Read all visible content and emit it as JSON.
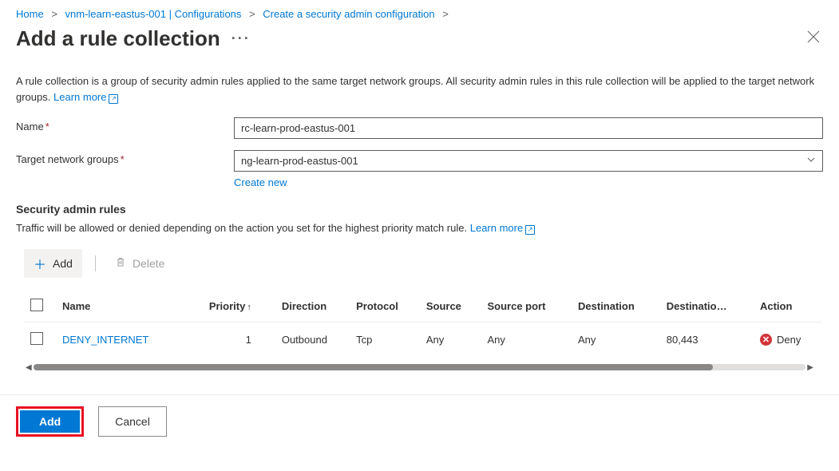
{
  "breadcrumb": {
    "items": [
      "Home",
      "vnm-learn-eastus-001 | Configurations",
      "Create a security admin configuration"
    ],
    "sep": ">"
  },
  "header": {
    "title": "Add a rule collection"
  },
  "description": {
    "text": "A rule collection is a group of security admin rules applied to the same target network groups. All security admin rules in this rule collection will be applied to the target network groups.",
    "learn_more": "Learn more"
  },
  "form": {
    "name_label": "Name",
    "name_value": "rc-learn-prod-eastus-001",
    "target_label": "Target network groups",
    "target_value": "ng-learn-prod-eastus-001",
    "create_new": "Create new"
  },
  "rules_section": {
    "title": "Security admin rules",
    "desc": "Traffic will be allowed or denied depending on the action you set for the highest priority match rule.",
    "learn_more": "Learn more",
    "toolbar": {
      "add": "Add",
      "delete": "Delete"
    },
    "columns": {
      "name": "Name",
      "priority": "Priority",
      "direction": "Direction",
      "protocol": "Protocol",
      "source": "Source",
      "source_port": "Source port",
      "destination": "Destination",
      "dest_port": "Destinatio…",
      "action": "Action"
    },
    "rows": [
      {
        "name": "DENY_INTERNET",
        "priority": "1",
        "direction": "Outbound",
        "protocol": "Tcp",
        "source": "Any",
        "source_port": "Any",
        "destination": "Any",
        "dest_port": "80,443",
        "action": "Deny"
      }
    ]
  },
  "footer": {
    "add": "Add",
    "cancel": "Cancel"
  }
}
